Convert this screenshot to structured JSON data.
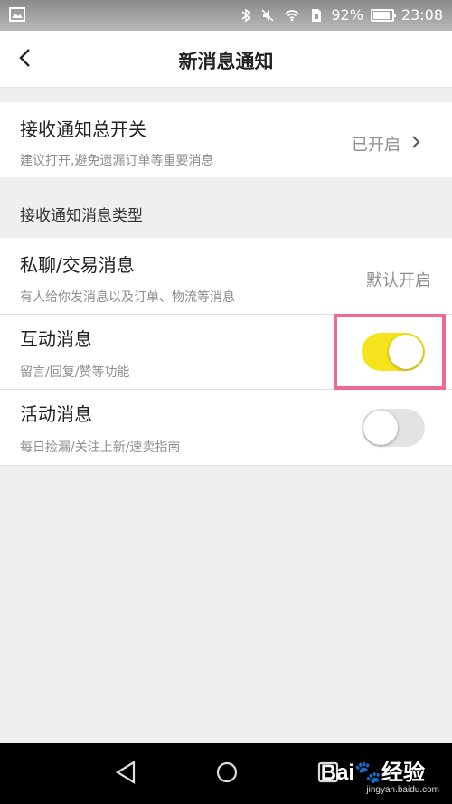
{
  "status_bar": {
    "battery": "92%",
    "time": "23:08",
    "icons": [
      "image-icon",
      "bluetooth-icon",
      "mute-icon",
      "wifi-icon",
      "sim-icon",
      "battery-icon"
    ]
  },
  "header": {
    "title": "新消息通知",
    "back_icon": "chevron-left-icon"
  },
  "master_switch": {
    "title": "接收通知总开关",
    "subtitle": "建议打开,避免遗漏订单等重要消息",
    "value": "已开启"
  },
  "section": {
    "label": "接收通知消息类型"
  },
  "items": [
    {
      "title": "私聊/交易消息",
      "subtitle": "有人给你发消息以及订单、物流等消息",
      "value": "默认开启"
    },
    {
      "title": "互动消息",
      "subtitle": "留言/回复/赞等功能",
      "toggle": "on"
    },
    {
      "title": "活动消息",
      "subtitle": "每日捡漏/关注上新/速卖指南",
      "toggle": "off"
    }
  ],
  "colors": {
    "toggle_on": "#f5e31b",
    "toggle_off": "#e3e3e3",
    "highlight": "#ee6a93"
  },
  "watermark": {
    "brand": "Bai",
    "brand2": "经验",
    "url": "jingyan.baidu.com"
  }
}
